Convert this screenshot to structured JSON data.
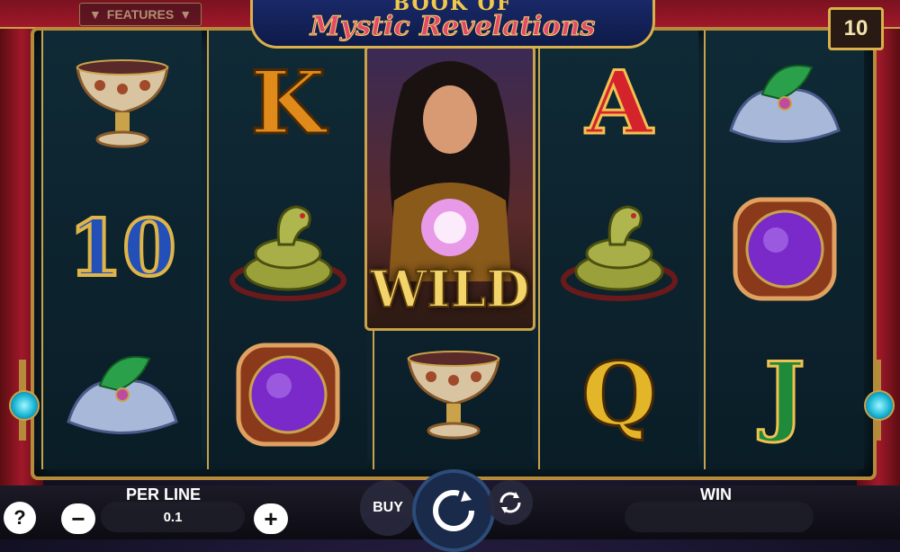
{
  "header": {
    "features_label": "FEATURES",
    "logo_top": "BOOK OF",
    "logo_bottom": "Mystic Revelations",
    "lines_count": "10"
  },
  "reels": [
    [
      "chalice-symbol",
      "10",
      "turban-symbol"
    ],
    [
      "K",
      "snake-symbol",
      "crystal-orb-symbol"
    ],
    [
      "wild-symbol",
      "wild-symbol",
      "chalice-symbol"
    ],
    [
      "A",
      "snake-symbol",
      "Q"
    ],
    [
      "turban-symbol",
      "crystal-orb-symbol",
      "J"
    ]
  ],
  "wild_label": "WILD",
  "controls": {
    "help_label": "?",
    "per_line_label": "PER LINE",
    "bet_value": "0.1",
    "minus_label": "−",
    "plus_label": "+",
    "buy_label": "BUY",
    "win_label": "WIN",
    "win_value": ""
  },
  "colors": {
    "gold": "#c9a24a",
    "curtain_red": "#a0182a",
    "lamp_cyan": "#18b4d4"
  }
}
